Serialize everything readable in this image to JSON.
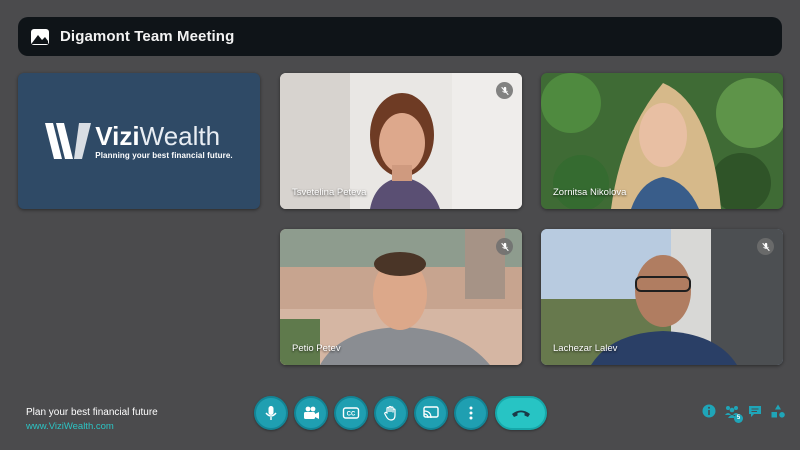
{
  "meeting": {
    "title": "Digamont Team Meeting",
    "title_icon": "picture-icon"
  },
  "brand": {
    "name_bold": "Vizi",
    "name_light": "Wealth",
    "tagline": "Planning your best financial future."
  },
  "participants": [
    {
      "name": "Tsvetelina Peteva",
      "muted": true
    },
    {
      "name": "Zornitsa Nikolova",
      "muted": false
    },
    {
      "name": "Petio Petev",
      "muted": true
    },
    {
      "name": "Lachezar Lalev",
      "muted": true
    }
  ],
  "footer": {
    "tagline": "Plan your best financial future",
    "link": "www.ViziWealth.com"
  },
  "controls": [
    {
      "icon": "microphone-icon"
    },
    {
      "icon": "camera-icon"
    },
    {
      "icon": "closed-captions-icon",
      "label": "CC"
    },
    {
      "icon": "raise-hand-icon"
    },
    {
      "icon": "screen-share-icon"
    },
    {
      "icon": "more-options-icon"
    },
    {
      "icon": "end-call-icon"
    }
  ],
  "right_icons": [
    {
      "icon": "info-icon"
    },
    {
      "icon": "participants-icon",
      "badge": "5"
    },
    {
      "icon": "chat-icon"
    },
    {
      "icon": "activities-icon"
    }
  ],
  "colors": {
    "accent": "#1f9fb1",
    "end_call": "#27c4c4",
    "link": "#2cc4c4",
    "background": "#4b4b4d",
    "title_bar": "#0f1418",
    "brand_tile": "#2f4a66"
  }
}
